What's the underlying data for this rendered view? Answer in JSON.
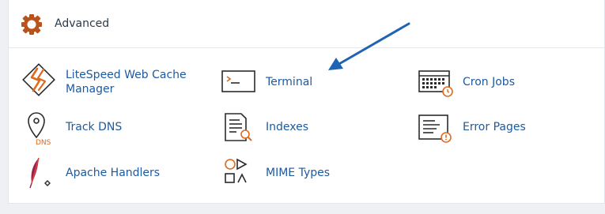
{
  "section": {
    "title": "Advanced",
    "icon": "gear-icon",
    "accent": "#c25a1c"
  },
  "items": [
    {
      "label_line1": "LiteSpeed Web Cache",
      "label_line2": "Manager",
      "icon": "litespeed-icon"
    },
    {
      "label": "Terminal",
      "icon": "terminal-icon"
    },
    {
      "label": "Cron Jobs",
      "icon": "cron-jobs-icon"
    },
    {
      "label": "Track DNS",
      "icon": "track-dns-icon",
      "icon_text": "DNS"
    },
    {
      "label": "Indexes",
      "icon": "indexes-icon"
    },
    {
      "label": "Error Pages",
      "icon": "error-pages-icon"
    },
    {
      "label": "Apache Handlers",
      "icon": "apache-handlers-icon"
    },
    {
      "label": "MIME Types",
      "icon": "mime-types-icon"
    }
  ],
  "annotation": {
    "arrow_color": "#1f63b5",
    "points_to": "Terminal"
  },
  "colors": {
    "link": "#1e5aa0",
    "icon_stroke": "#2b2b2b",
    "icon_accent": "#e06b1f"
  }
}
